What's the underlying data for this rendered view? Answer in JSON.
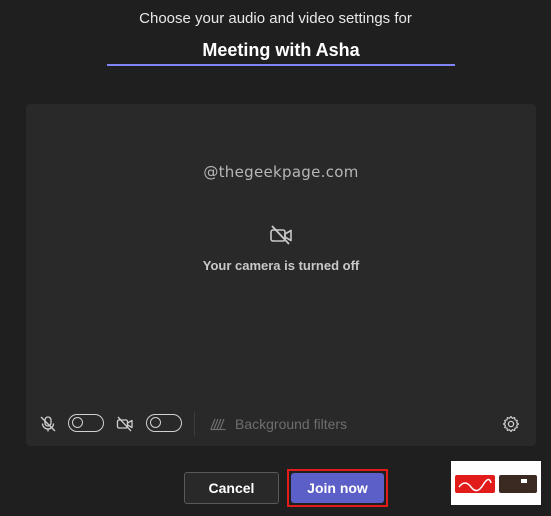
{
  "header": {
    "prompt": "Choose your audio and video settings for",
    "meeting_title": "Meeting with Asha"
  },
  "preview": {
    "watermark": "@thegeekpage.com",
    "camera_status": "Your camera is turned off"
  },
  "controls": {
    "mic_toggle": "off",
    "camera_toggle": "off",
    "background_filters_label": "Background filters"
  },
  "actions": {
    "cancel_label": "Cancel",
    "join_label": "Join now"
  },
  "colors": {
    "accent": "#5b5fc7",
    "underline": "#7f85f5",
    "highlight": "#e21b1b",
    "background": "#1f1f1f",
    "panel": "#292929"
  }
}
